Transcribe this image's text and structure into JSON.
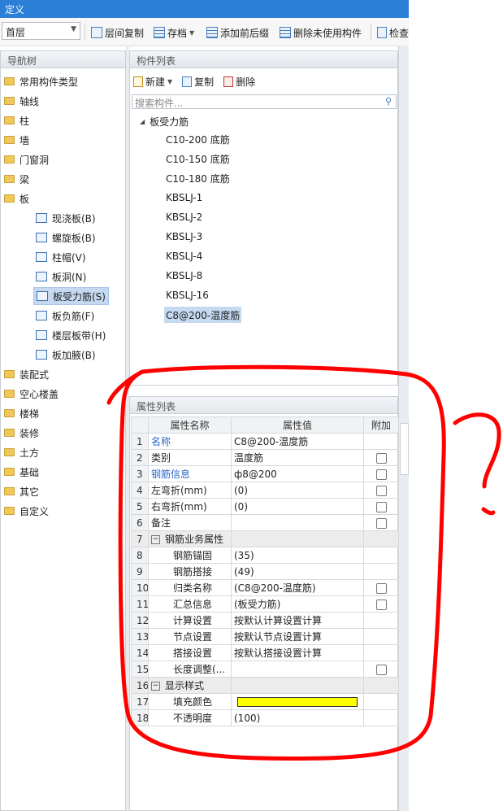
{
  "window": {
    "title": "定义"
  },
  "toolbar": {
    "floor_value": "首层",
    "copy_between_floors": "层间复制",
    "save_archive": "存档",
    "add_prefix_suffix": "添加前后缀",
    "delete_unused": "删除未使用构件",
    "check": "检查"
  },
  "nav": {
    "header": "导航树",
    "items": [
      {
        "label": "常用构件类型"
      },
      {
        "label": "轴线"
      },
      {
        "label": "柱"
      },
      {
        "label": "墙"
      },
      {
        "label": "门窗洞"
      },
      {
        "label": "梁"
      },
      {
        "label": "板"
      }
    ],
    "sub_items": [
      {
        "label": "现浇板(B)"
      },
      {
        "label": "螺旋板(B)"
      },
      {
        "label": "柱帽(V)"
      },
      {
        "label": "板洞(N)"
      },
      {
        "label": "板受力筋(S)"
      },
      {
        "label": "板负筋(F)"
      },
      {
        "label": "楼层板带(H)"
      },
      {
        "label": "板加腋(B)"
      }
    ],
    "items_after": [
      {
        "label": "装配式"
      },
      {
        "label": "空心楼盖"
      },
      {
        "label": "楼梯"
      },
      {
        "label": "装修"
      },
      {
        "label": "土方"
      },
      {
        "label": "基础"
      },
      {
        "label": "其它"
      },
      {
        "label": "自定义"
      }
    ]
  },
  "component_list": {
    "header": "构件列表",
    "new_label": "新建",
    "copy_label": "复制",
    "delete_label": "删除",
    "search_placeholder": "搜索构件...",
    "root_label": "板受力筋",
    "items": [
      {
        "label": "C10-200 底筋"
      },
      {
        "label": "C10-150 底筋"
      },
      {
        "label": "C10-180 底筋"
      },
      {
        "label": "KBSLJ-1"
      },
      {
        "label": "KBSLJ-2"
      },
      {
        "label": "KBSLJ-3"
      },
      {
        "label": "KBSLJ-4"
      },
      {
        "label": "KBSLJ-8"
      },
      {
        "label": "KBSLJ-16"
      },
      {
        "label": "C8@200-温度筋"
      }
    ]
  },
  "properties": {
    "header": "属性列表",
    "col_name": "属性名称",
    "col_value": "属性值",
    "col_extra": "附加",
    "rows": [
      {
        "num": "1",
        "name": "名称",
        "value": "C8@200-温度筋"
      },
      {
        "num": "2",
        "name": "类别",
        "value": "温度筋"
      },
      {
        "num": "3",
        "name": "钢筋信息",
        "value": "ф8@200"
      },
      {
        "num": "4",
        "name": "左弯折(mm)",
        "value": "(0)"
      },
      {
        "num": "5",
        "name": "右弯折(mm)",
        "value": "(0)"
      },
      {
        "num": "6",
        "name": "备注",
        "value": ""
      },
      {
        "num": "7",
        "name": "钢筋业务属性",
        "value": ""
      },
      {
        "num": "8",
        "name": "钢筋锚固",
        "value": "(35)"
      },
      {
        "num": "9",
        "name": "钢筋搭接",
        "value": "(49)"
      },
      {
        "num": "10",
        "name": "归类名称",
        "value": "(C8@200-温度筋)"
      },
      {
        "num": "11",
        "name": "汇总信息",
        "value": "(板受力筋)"
      },
      {
        "num": "12",
        "name": "计算设置",
        "value": "按默认计算设置计算"
      },
      {
        "num": "13",
        "name": "节点设置",
        "value": "按默认节点设置计算"
      },
      {
        "num": "14",
        "name": "搭接设置",
        "value": "按默认搭接设置计算"
      },
      {
        "num": "15",
        "name": "长度调整(...",
        "value": ""
      },
      {
        "num": "16",
        "name": "显示样式",
        "value": ""
      },
      {
        "num": "17",
        "name": "填充颜色",
        "value": ""
      },
      {
        "num": "18",
        "name": "不透明度",
        "value": "(100)"
      }
    ],
    "fill_color": "#ffff00"
  },
  "annotation": {
    "mark": "?",
    "color": "#ff0000"
  }
}
